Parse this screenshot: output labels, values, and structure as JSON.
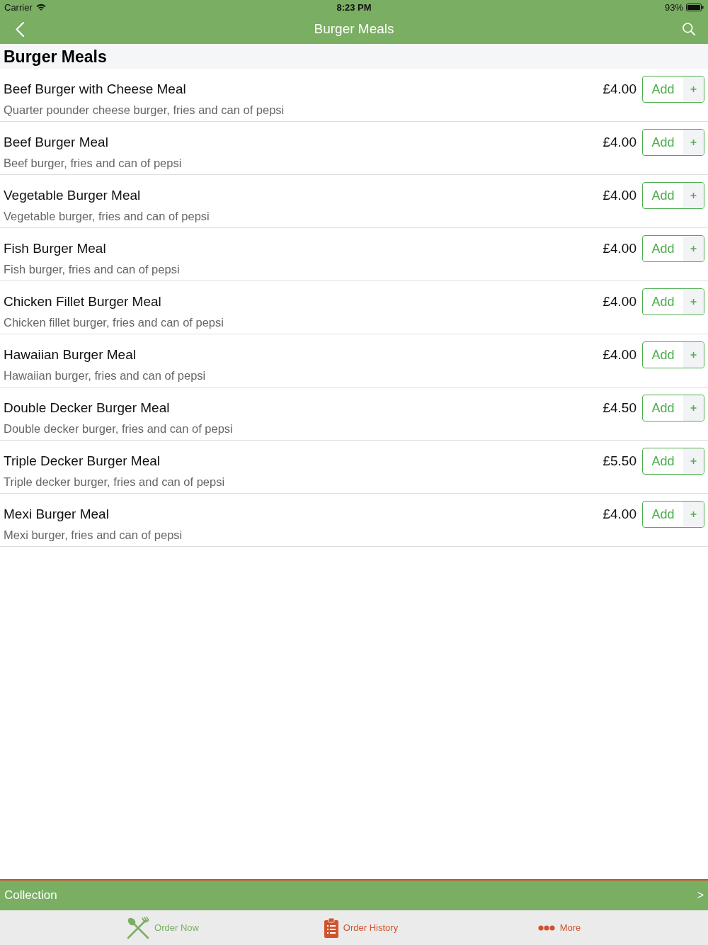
{
  "status_bar": {
    "carrier": "Carrier",
    "time": "8:23 PM",
    "battery": "93%"
  },
  "nav_bar": {
    "title": "Burger Meals"
  },
  "section": {
    "title": "Burger Meals"
  },
  "items": [
    {
      "name": "Beef Burger with Cheese Meal",
      "description": "Quarter pounder cheese burger, fries and can of pepsi",
      "price": "£4.00",
      "button": "Add"
    },
    {
      "name": "Beef Burger Meal",
      "description": "Beef burger, fries and can of pepsi",
      "price": "£4.00",
      "button": "Add"
    },
    {
      "name": "Vegetable Burger Meal",
      "description": "Vegetable burger, fries and can of pepsi",
      "price": "£4.00",
      "button": "Add"
    },
    {
      "name": "Fish Burger Meal",
      "description": "Fish burger, fries and can of pepsi",
      "price": "£4.00",
      "button": "Add"
    },
    {
      "name": "Chicken Fillet Burger Meal",
      "description": "Chicken fillet burger, fries and can of pepsi",
      "price": "£4.00",
      "button": "Add"
    },
    {
      "name": "Hawaiian Burger Meal",
      "description": "Hawaiian burger, fries and can of pepsi",
      "price": "£4.00",
      "button": "Add"
    },
    {
      "name": "Double Decker Burger Meal",
      "description": "Double decker burger, fries and can of pepsi",
      "price": "£4.50",
      "button": "Add"
    },
    {
      "name": "Triple Decker Burger Meal",
      "description": "Triple decker burger, fries and can of pepsi",
      "price": "£5.50",
      "button": "Add"
    },
    {
      "name": "Mexi Burger Meal",
      "description": "Mexi burger, fries and can of pepsi",
      "price": "£4.00",
      "button": "Add"
    }
  ],
  "collection_bar": {
    "label": "Collection",
    "arrow": ">"
  },
  "tabs": [
    {
      "label": "Order Now",
      "kind": "utensils",
      "selected": true
    },
    {
      "label": "Order History",
      "kind": "clipboard",
      "selected": false
    },
    {
      "label": "More",
      "kind": "dots",
      "selected": false
    }
  ]
}
